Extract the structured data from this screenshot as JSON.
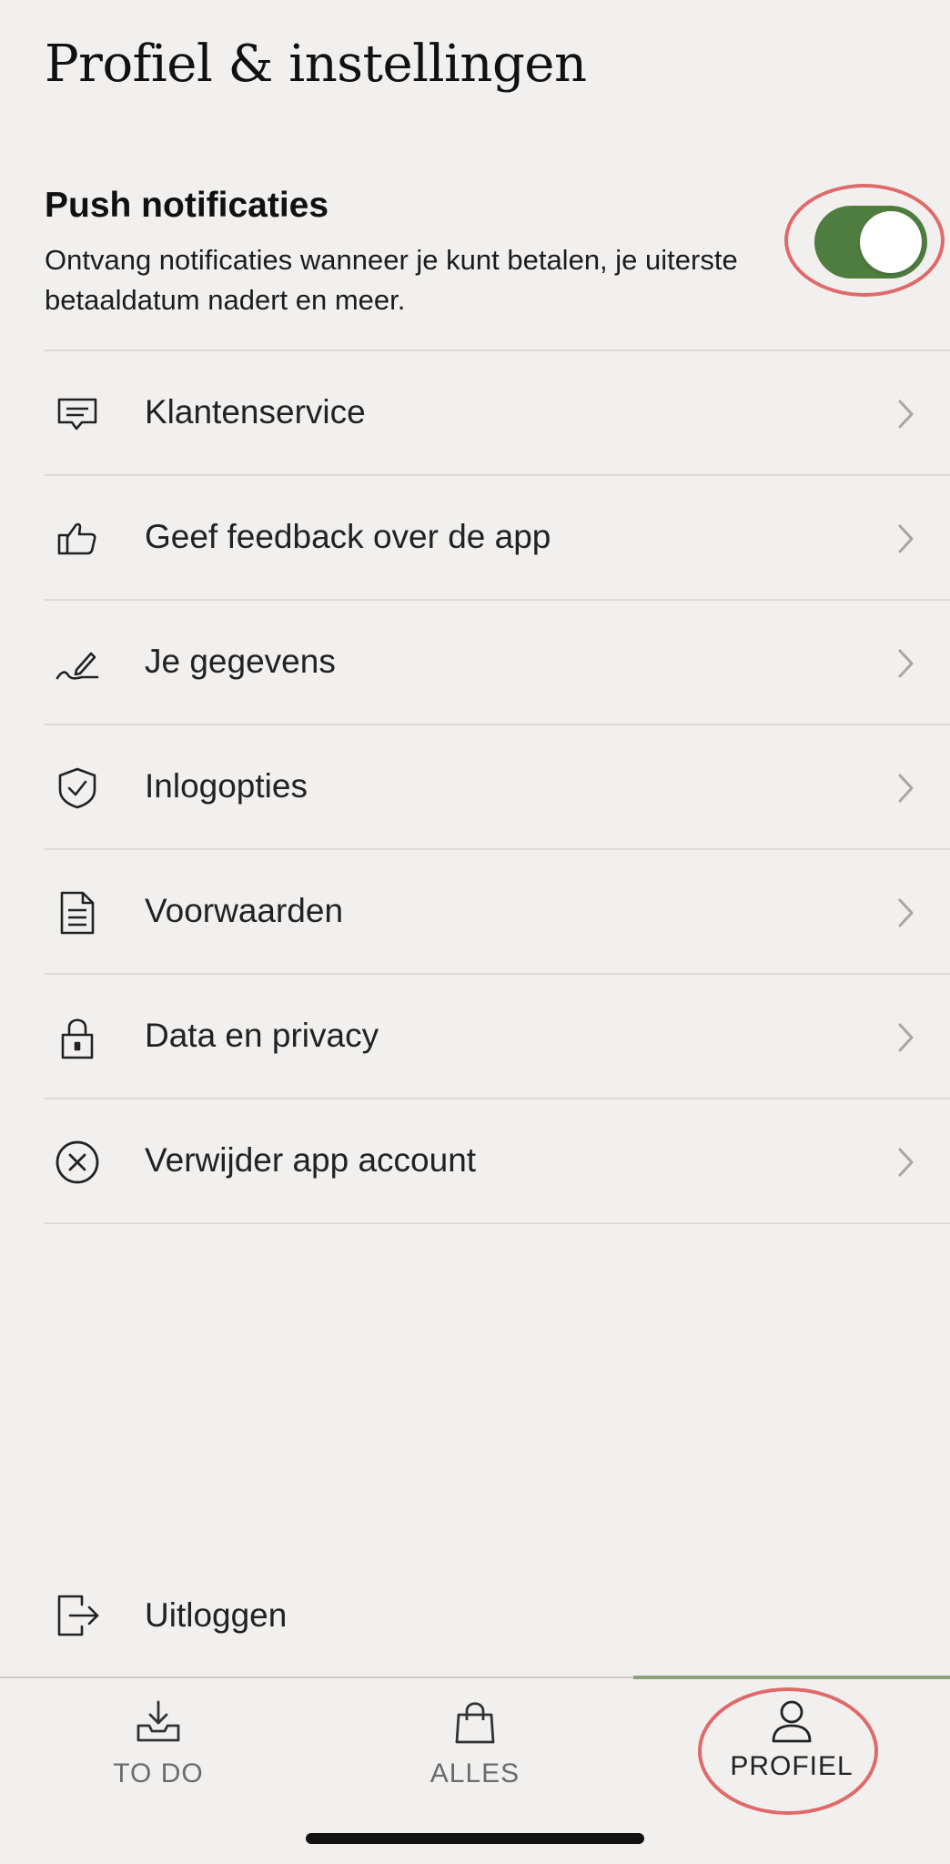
{
  "page": {
    "title": "Profiel & instellingen"
  },
  "push": {
    "title": "Push notificaties",
    "description": "Ontvang notificaties wanneer je kunt betalen, je uiterste betaaldatum nadert en meer.",
    "enabled": true,
    "toggle_color": "#4f7d3f"
  },
  "menu": {
    "items": [
      {
        "label": "Klantenservice",
        "icon": "chat-icon"
      },
      {
        "label": "Geef feedback over de app",
        "icon": "thumbs-up-icon"
      },
      {
        "label": "Je gegevens",
        "icon": "pen-signature-icon"
      },
      {
        "label": "Inlogopties",
        "icon": "shield-check-icon"
      },
      {
        "label": "Voorwaarden",
        "icon": "document-icon"
      },
      {
        "label": "Data en privacy",
        "icon": "lock-icon"
      },
      {
        "label": "Verwijder app account",
        "icon": "circle-x-icon"
      }
    ]
  },
  "logout": {
    "label": "Uitloggen",
    "icon": "logout-icon"
  },
  "nav": {
    "tabs": [
      {
        "label": "TO DO",
        "icon": "inbox-download-icon",
        "active": false
      },
      {
        "label": "ALLES",
        "icon": "shopping-bag-icon",
        "active": false
      },
      {
        "label": "PROFIEL",
        "icon": "user-icon",
        "active": true
      }
    ]
  },
  "colors": {
    "background": "#f2f0ee",
    "accent": "#4f7d3f",
    "highlight": "#e06a6a"
  }
}
